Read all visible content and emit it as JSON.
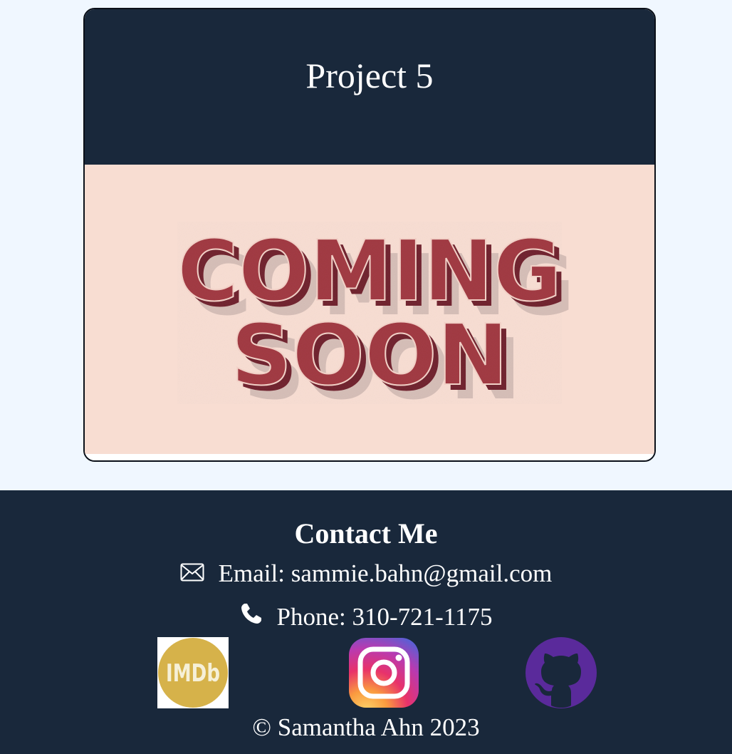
{
  "project": {
    "title": "Project 5",
    "image_text_line1": "COMING",
    "image_text_line2": "SOON"
  },
  "footer": {
    "heading": "Contact Me",
    "email": "Email: sammie.bahn@gmail.com",
    "phone": "Phone: 310-721-1175",
    "copyright": "© Samantha Ahn 2023",
    "social": [
      {
        "name": "imdb",
        "label": "IMDb",
        "icon": "imdb-icon"
      },
      {
        "name": "instagram",
        "icon": "instagram-icon"
      },
      {
        "name": "github",
        "icon": "github-icon"
      }
    ]
  },
  "colors": {
    "page_bg": "#f0f7ff",
    "navy": "#19283b",
    "coming_soon_red": "#a23a44",
    "coming_soon_bg": "#f8ddd2",
    "imdb_gold": "#d6b24a",
    "github_purple": "#5a2a9b"
  }
}
